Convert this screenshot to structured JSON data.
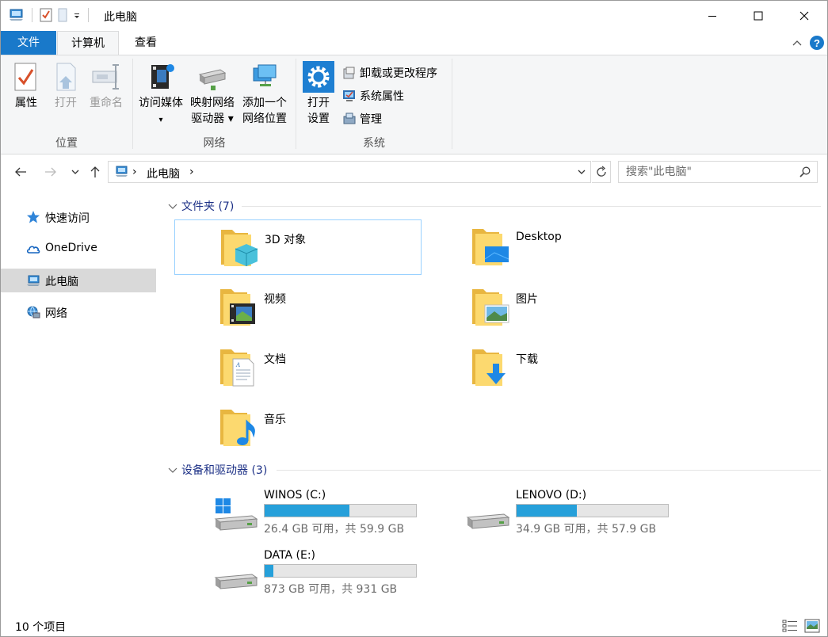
{
  "window": {
    "title": "此电脑",
    "buttons": {
      "minimize": "minimize",
      "maximize": "maximize",
      "close": "close"
    }
  },
  "ribbon": {
    "tabs": [
      {
        "label": "文件"
      },
      {
        "label": "计算机"
      },
      {
        "label": "查看"
      }
    ],
    "groups": {
      "location": {
        "label": "位置",
        "buttons": [
          {
            "label": "属性"
          },
          {
            "label": "打开"
          },
          {
            "label": "重命名"
          }
        ]
      },
      "network": {
        "label": "网络",
        "buttons": [
          {
            "label": "访问媒体",
            "label2": "▾"
          },
          {
            "label": "映射网络",
            "label2": "驱动器 ▾"
          },
          {
            "label": "添加一个",
            "label2": "网络位置"
          }
        ]
      },
      "system": {
        "label": "系统",
        "open_settings": {
          "label": "打开",
          "label2": "设置"
        },
        "small": [
          {
            "label": "卸载或更改程序"
          },
          {
            "label": "系统属性"
          },
          {
            "label": "管理"
          }
        ]
      }
    },
    "accent": "#1979ca"
  },
  "address": {
    "path": "此电脑",
    "separator": "›",
    "search_placeholder": "搜索\"此电脑\""
  },
  "sidebar": {
    "items": [
      {
        "label": "快速访问",
        "icon": "star-icon"
      },
      {
        "label": "OneDrive",
        "icon": "cloud-icon"
      },
      {
        "label": "此电脑",
        "icon": "computer-icon"
      },
      {
        "label": "网络",
        "icon": "network-icon"
      }
    ]
  },
  "folders": {
    "header": "文件夹 (7)",
    "items": [
      {
        "name": "3D 对象",
        "icon": "3d-objects-folder-icon"
      },
      {
        "name": "Desktop",
        "icon": "desktop-folder-icon"
      },
      {
        "name": "视频",
        "icon": "videos-folder-icon"
      },
      {
        "name": "图片",
        "icon": "pictures-folder-icon"
      },
      {
        "name": "文档",
        "icon": "documents-folder-icon"
      },
      {
        "name": "下载",
        "icon": "downloads-folder-icon"
      },
      {
        "name": "音乐",
        "icon": "music-folder-icon"
      }
    ]
  },
  "drives": {
    "header": "设备和驱动器 (3)",
    "items": [
      {
        "name": "WINOS (C:)",
        "free": "26.4 GB 可用，共 59.9 GB",
        "used_fraction": 0.56
      },
      {
        "name": "LENOVO (D:)",
        "free": "34.9 GB 可用，共 57.9 GB",
        "used_fraction": 0.4
      },
      {
        "name": "DATA (E:)",
        "free": "873 GB 可用，共 931 GB",
        "used_fraction": 0.06
      }
    ],
    "bar_color": "#26a0da"
  },
  "status": {
    "count": "10 个项目"
  }
}
